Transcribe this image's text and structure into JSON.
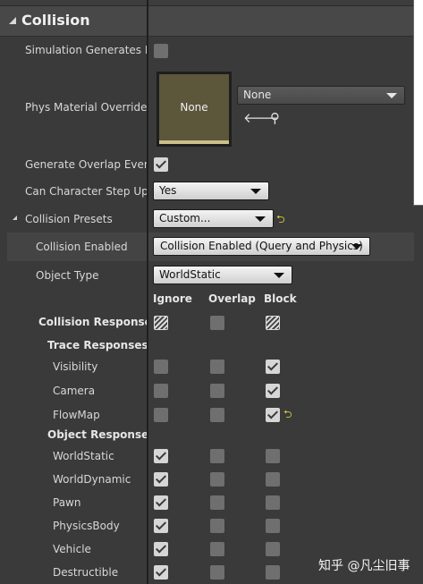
{
  "header": {
    "title": "Collision"
  },
  "props": {
    "simulation_label": "Simulation Generates Hi",
    "phys_label": "Phys Material Override",
    "phys_thumb": "None",
    "phys_value": "None",
    "overlap_label": "Generate Overlap Events",
    "step_label": "Can Character Step Up O",
    "step_value": "Yes",
    "presets_label": "Collision Presets",
    "presets_value": "Custom...",
    "enabled_label": "Collision Enabled",
    "enabled_value": "Collision Enabled (Query and Physics)",
    "object_label": "Object Type",
    "object_value": "WorldStatic"
  },
  "columns": {
    "ignore": "Ignore",
    "overlap": "Overlap",
    "block": "Block"
  },
  "responses": {
    "collision_responses": "Collision Responses",
    "trace_responses": "Trace Responses",
    "object_response": "Object Response"
  },
  "trace": [
    {
      "label": "Visibility",
      "ignore": false,
      "overlap": false,
      "block": true
    },
    {
      "label": "Camera",
      "ignore": false,
      "overlap": false,
      "block": true
    },
    {
      "label": "FlowMap",
      "ignore": false,
      "overlap": false,
      "block": true
    }
  ],
  "objects": [
    {
      "label": "WorldStatic",
      "ignore": true,
      "overlap": false,
      "block": false
    },
    {
      "label": "WorldDynamic",
      "ignore": true,
      "overlap": false,
      "block": false
    },
    {
      "label": "Pawn",
      "ignore": true,
      "overlap": false,
      "block": false
    },
    {
      "label": "PhysicsBody",
      "ignore": true,
      "overlap": false,
      "block": false
    },
    {
      "label": "Vehicle",
      "ignore": true,
      "overlap": false,
      "block": false
    },
    {
      "label": "Destructible",
      "ignore": true,
      "overlap": false,
      "block": false
    }
  ],
  "watermark": "知乎 @凡尘旧事",
  "colors": {
    "panel": "#3a3a3a",
    "header": "#484848",
    "reset_accent": "#d7c742"
  },
  "icons": [
    "collapse-triangle-icon",
    "checkbox-icon",
    "use-selected-arrow-icon",
    "browse-magnifier-icon",
    "reset-to-default-icon",
    "chevron-down-icon"
  ]
}
